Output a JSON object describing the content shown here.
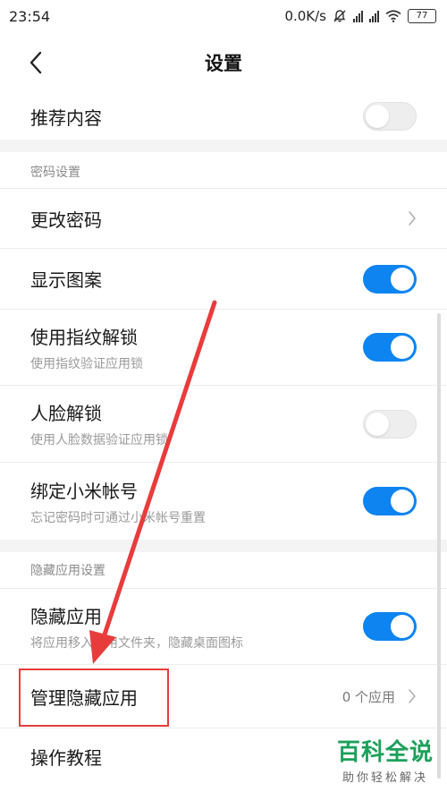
{
  "status_bar": {
    "time": "23:54",
    "network_speed": "0.0K/s",
    "battery": "77",
    "icons": [
      "bell-off-icon",
      "signal-icon",
      "signal-icon",
      "wifi-icon",
      "battery-icon"
    ]
  },
  "header": {
    "title": "设置",
    "back_icon": "chevron-left-icon"
  },
  "rows": {
    "recommend": {
      "title": "推荐内容",
      "toggle": "off"
    },
    "password_section": "密码设置",
    "change_password": {
      "title": "更改密码",
      "icon": "chevron-right-icon"
    },
    "show_pattern": {
      "title": "显示图案",
      "toggle": "on"
    },
    "fingerprint": {
      "title": "使用指纹解锁",
      "subtitle": "使用指纹验证应用锁",
      "toggle": "on"
    },
    "face_unlock": {
      "title": "人脸解锁",
      "subtitle": "使用人脸数据验证应用锁",
      "toggle": "off"
    },
    "mi_account": {
      "title": "绑定小米帐号",
      "subtitle": "忘记密码时可通过小米帐号重置",
      "toggle": "on"
    },
    "hidden_section": "隐藏应用设置",
    "hide_apps": {
      "title": "隐藏应用",
      "subtitle": "将应用移入应用文件夹，隐藏桌面图标",
      "toggle": "on"
    },
    "manage_hidden": {
      "title": "管理隐藏应用",
      "value": "0 个应用",
      "icon": "chevron-right-icon"
    },
    "tutorial": {
      "title": "操作教程"
    }
  },
  "colors": {
    "toggle_on": "#0d84f0",
    "annotation_red": "#e83c3c",
    "watermark_green": "#1ba15a"
  },
  "watermark": {
    "title": "百科全说",
    "subtitle": "助你轻松解决"
  }
}
